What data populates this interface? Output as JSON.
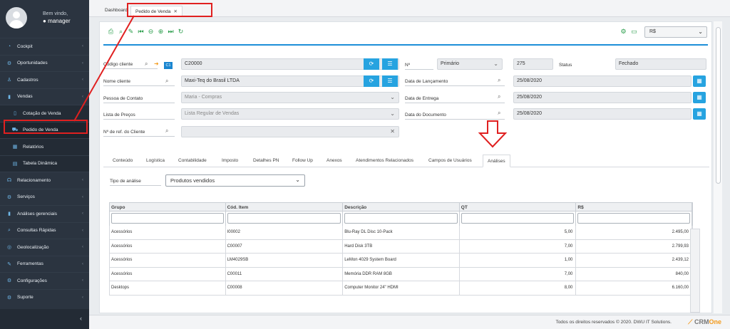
{
  "sidebar": {
    "welcome": "Bem vindo,",
    "username": "manager",
    "items": [
      {
        "label": "Cockpit",
        "icon": "cockpit-icon",
        "glyph": "◔"
      },
      {
        "label": "Oportunidades",
        "icon": "opportunities-icon",
        "glyph": "⚙"
      },
      {
        "label": "Cadastros",
        "icon": "user-icon",
        "glyph": "♙"
      },
      {
        "label": "Vendas",
        "icon": "chart-icon",
        "glyph": "▮"
      },
      {
        "label": "Cotação de Venda",
        "icon": "document-icon",
        "glyph": "▯"
      },
      {
        "label": "Pedido de Venda",
        "icon": "cart-icon",
        "glyph": "⛟"
      },
      {
        "label": "Relatórios",
        "icon": "report-icon",
        "glyph": "▦"
      },
      {
        "label": "Tabela Dinâmica",
        "icon": "table-icon",
        "glyph": "▤"
      },
      {
        "label": "Relacionamento",
        "icon": "relationship-icon",
        "glyph": "☊"
      },
      {
        "label": "Serviços",
        "icon": "services-icon",
        "glyph": "⚙"
      },
      {
        "label": "Análises gerenciais",
        "icon": "analytics-icon",
        "glyph": "▮"
      },
      {
        "label": "Consultas Rápidas",
        "icon": "search-icon",
        "glyph": "⌕"
      },
      {
        "label": "Geolocalização",
        "icon": "geo-icon",
        "glyph": "◎"
      },
      {
        "label": "Ferramentas",
        "icon": "tools-icon",
        "glyph": "✎"
      },
      {
        "label": "Configurações",
        "icon": "settings-icon",
        "glyph": "⚙"
      },
      {
        "label": "Suporte",
        "icon": "support-icon",
        "glyph": "⚙"
      }
    ]
  },
  "tabs": {
    "dashboard": "Dashboard",
    "pedido": "Pedido de Venda"
  },
  "toolbar": {
    "currency": "R$"
  },
  "form": {
    "codigo_cliente_label": "Código cliente",
    "codigo_cliente_badge": "C1",
    "codigo_cliente_value": "C20000",
    "nome_cliente_label": "Nome cliente",
    "nome_cliente_value": "Maxi-Teq do Brasil LTDA",
    "pessoa_contato_label": "Pessoa de Contato",
    "pessoa_contato_value": "Maria - Compras",
    "lista_precos_label": "Lista de Preços",
    "lista_precos_value": "Lista Regular de Vendas",
    "ref_cliente_label": "Nº de ref. do Cliente",
    "numero_label": "Nº",
    "numero_series": "Primário",
    "numero_value": "275",
    "status_label": "Status",
    "status_value": "Fechado",
    "data_lancamento_label": "Data de Lançamento",
    "data_lancamento_value": "25/08/2020",
    "data_entrega_label": "Data de Entrega",
    "data_entrega_value": "25/08/2020",
    "data_documento_label": "Data do Documento",
    "data_documento_value": "25/08/2020"
  },
  "subtabs": [
    "Conteúdo",
    "Logística",
    "Contabilidade",
    "Imposto",
    "Detalhes PN",
    "Follow Up",
    "Anexos",
    "Atendimentos Relacionados",
    "Campos de Usuários",
    "Análises"
  ],
  "analysis": {
    "label": "Tipo de análise",
    "value": "Produtos vendidos"
  },
  "grid": {
    "headers": [
      "Grupo",
      "Cód. Item",
      "Descrição",
      "QT",
      "R$"
    ],
    "rows": [
      [
        "Acessórios",
        "I00002",
        "Blu-Ray DL Disc 10-Pack",
        "5,00",
        "2.495,00"
      ],
      [
        "Acessórios",
        "C00007",
        "Hard Disk 3TB",
        "7,00",
        "2.799,93"
      ],
      [
        "Acessórios",
        "LM4029SB",
        "LeMon 4029 System Board",
        "1,00",
        "2.439,12"
      ],
      [
        "Acessórios",
        "C00011",
        "Memória DDR RAM 8GB",
        "7,00",
        "840,00"
      ],
      [
        "Desktops",
        "C00008",
        "Computer Monitor 24\" HDMI",
        "8,00",
        "6.160,00"
      ]
    ]
  },
  "footer": {
    "copyright": "Todos os direitos reservados © 2020.  DWU IT Solutions.",
    "logo_a": "CRM",
    "logo_b": "One"
  },
  "colors": {
    "accent": "#1d8fd8",
    "annotation": "#e02020",
    "sidebar": "#2b3440"
  }
}
